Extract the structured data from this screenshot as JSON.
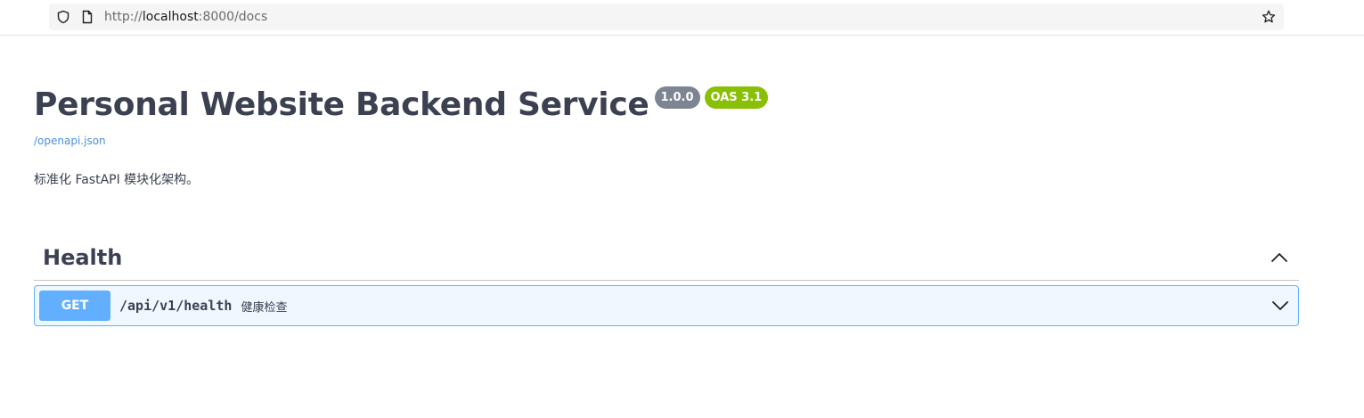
{
  "browser": {
    "url_prefix": "http://",
    "url_host": "localhost",
    "url_rest": ":8000/docs",
    "icons": [
      "shield-icon",
      "page-icon",
      "bookmark-star-icon"
    ]
  },
  "info": {
    "title": "Personal Website Backend Service",
    "version": "1.0.0",
    "oas_version": "OAS 3.1",
    "spec_link": "/openapi.json",
    "description": "标准化 FastAPI 模块化架构。"
  },
  "tags": [
    {
      "name": "Health",
      "expanded": true,
      "operations": [
        {
          "method": "GET",
          "path": "/api/v1/health",
          "summary": "健康检查"
        }
      ]
    }
  ],
  "colors": {
    "get_method": "#61affe",
    "version_badge": "#7d8492",
    "oas_badge": "#89bf04",
    "link": "#4990e2",
    "text": "#3b4151"
  }
}
